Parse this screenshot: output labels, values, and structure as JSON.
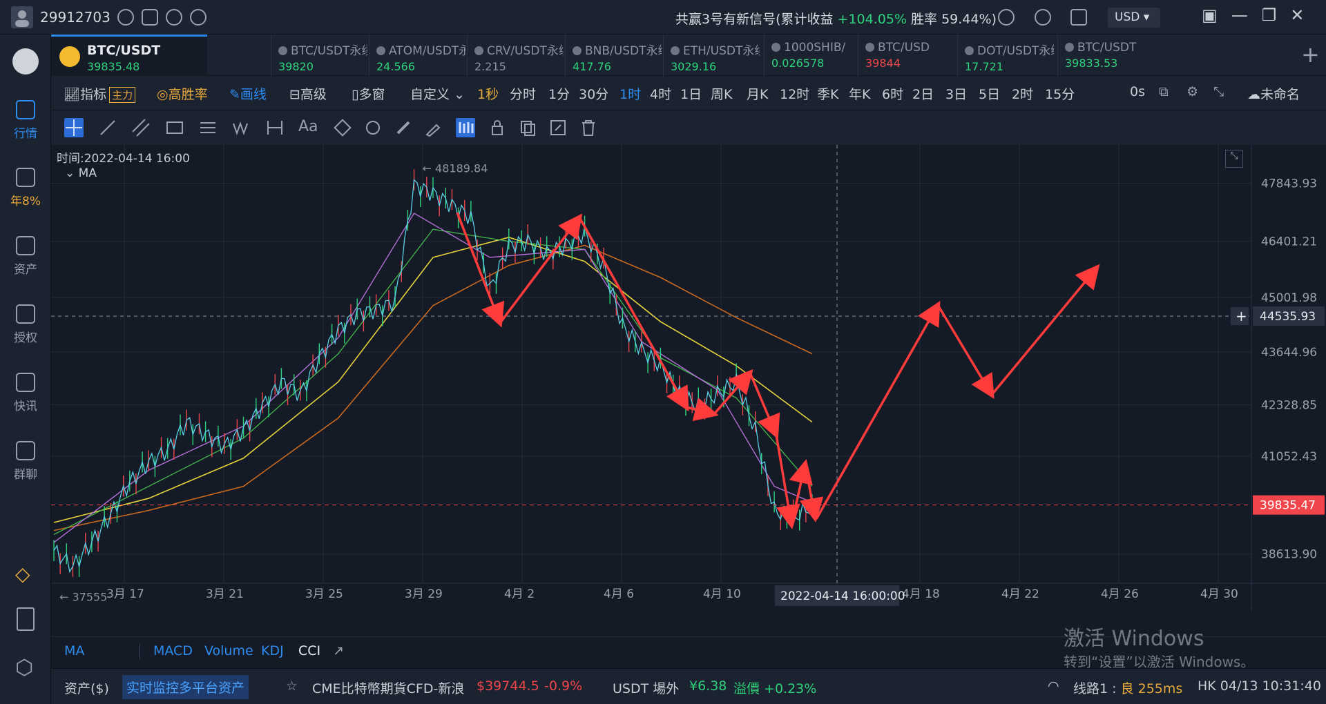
{
  "topbar": {
    "user_id": "29912703",
    "signal_prefix": "共赢3号有新信号(累计收益 ",
    "signal_gain": "+104.05%",
    "signal_winrate": " 胜率 59.44%)",
    "currency": "USD"
  },
  "sidebar": {
    "items": [
      {
        "label": "行情",
        "icon": "market-icon"
      },
      {
        "label": "年8%",
        "icon": "earn-icon"
      },
      {
        "label": "资产",
        "icon": "wallet-icon"
      },
      {
        "label": "授权",
        "icon": "key-icon"
      },
      {
        "label": "快讯",
        "icon": "news-icon"
      },
      {
        "label": "群聊",
        "icon": "chat-icon"
      }
    ]
  },
  "tabs": [
    {
      "name": "BTC/USDT",
      "price": "39835.48",
      "color": "green"
    },
    {
      "name": "BTC/USDT永续",
      "price": "39820",
      "color": "green"
    },
    {
      "name": "ATOM/USDT永续",
      "price": "24.566",
      "color": "green"
    },
    {
      "name": "CRV/USDT永续",
      "price": "2.215",
      "color": "gray"
    },
    {
      "name": "BNB/USDT永续",
      "price": "417.76",
      "color": "green"
    },
    {
      "name": "ETH/USDT永续",
      "price": "3029.16",
      "color": "green"
    },
    {
      "name": "1000SHIB/",
      "price": "0.026578",
      "color": "green"
    },
    {
      "name": "BTC/USD",
      "price": "39844",
      "color": "red"
    },
    {
      "name": "DOT/USDT永续",
      "price": "17.721",
      "color": "green"
    },
    {
      "name": "BTC/USDT",
      "price": "39833.53",
      "color": "green"
    }
  ],
  "interval_bar": {
    "indicator": "指标",
    "main_tag": "主力",
    "high_win": "高胜率",
    "draw": "画线",
    "advanced": "高级",
    "multi": "多窗",
    "custom": "自定义",
    "intervals": [
      "1秒",
      "分时",
      "1分",
      "30分",
      "1时",
      "4时",
      "1日",
      "周K",
      "月K",
      "12时",
      "季K",
      "年K",
      "6时",
      "2日",
      "3日",
      "5日",
      "2时",
      "15分"
    ],
    "active_interval": "1时",
    "countdown": "0s",
    "layout_name": "未命名"
  },
  "chart": {
    "time_label": "时间:2022-04-14 16:00",
    "ma_label": "MA",
    "high_label": "← 48189.84",
    "low_label": "← 37555",
    "crosshair_date": "2022-04-14 16:00:00",
    "crosshair_price": "44535.93",
    "current_price": "39835.47",
    "price_ticks": [
      "47843.93",
      "46401.21",
      "45001.98",
      "43644.96",
      "42328.85",
      "41052.43",
      "38613.90"
    ],
    "date_ticks": [
      "3月 17",
      "3月 21",
      "3月 25",
      "3月 29",
      "4月 2",
      "4月 6",
      "4月 10",
      "4月 18",
      "4月 22",
      "4月 26",
      "4月 30"
    ]
  },
  "chart_data": {
    "type": "line",
    "ylim": [
      37200,
      48800
    ],
    "yticks": [
      47843.93,
      46401.21,
      45001.98,
      43644.96,
      42328.85,
      41052.43,
      38613.9
    ],
    "high": 48189.84,
    "low": 37555,
    "current_price": 39835.47,
    "crosshair_price": 44535.93,
    "price_path": [
      [
        0,
        38700
      ],
      [
        2,
        38300
      ],
      [
        4,
        38900
      ],
      [
        6,
        39600
      ],
      [
        8,
        40400
      ],
      [
        10,
        40900
      ],
      [
        12,
        41200
      ],
      [
        14,
        41900
      ],
      [
        16,
        41600
      ],
      [
        18,
        41300
      ],
      [
        20,
        41700
      ],
      [
        22,
        42300
      ],
      [
        24,
        42900
      ],
      [
        26,
        42600
      ],
      [
        28,
        43500
      ],
      [
        30,
        44200
      ],
      [
        32,
        44600
      ],
      [
        34,
        44700
      ],
      [
        36,
        44900
      ],
      [
        38,
        47800
      ],
      [
        40,
        47600
      ],
      [
        42,
        47300
      ],
      [
        44,
        47000
      ],
      [
        46,
        45200
      ],
      [
        48,
        46300
      ],
      [
        50,
        46400
      ],
      [
        52,
        46100
      ],
      [
        54,
        46300
      ],
      [
        56,
        46600
      ],
      [
        58,
        45800
      ],
      [
        60,
        44300
      ],
      [
        62,
        43700
      ],
      [
        64,
        43300
      ],
      [
        66,
        42600
      ],
      [
        68,
        42300
      ],
      [
        70,
        42600
      ],
      [
        72,
        42900
      ],
      [
        74,
        41700
      ],
      [
        76,
        39700
      ],
      [
        78,
        39500
      ],
      [
        80,
        39835
      ]
    ],
    "ma_fast": [
      [
        0,
        38900
      ],
      [
        10,
        40700
      ],
      [
        20,
        41800
      ],
      [
        30,
        44000
      ],
      [
        38,
        47100
      ],
      [
        46,
        46000
      ],
      [
        56,
        46200
      ],
      [
        62,
        43900
      ],
      [
        70,
        42700
      ],
      [
        76,
        40300
      ],
      [
        80,
        39900
      ]
    ],
    "ma_mid": [
      [
        0,
        39100
      ],
      [
        10,
        40300
      ],
      [
        20,
        41500
      ],
      [
        30,
        43600
      ],
      [
        40,
        46700
      ],
      [
        48,
        46400
      ],
      [
        56,
        46200
      ],
      [
        64,
        43500
      ],
      [
        72,
        42500
      ],
      [
        80,
        40300
      ]
    ],
    "ma_slow": [
      [
        0,
        39400
      ],
      [
        10,
        40000
      ],
      [
        20,
        41000
      ],
      [
        30,
        42900
      ],
      [
        40,
        46000
      ],
      [
        48,
        46500
      ],
      [
        56,
        45900
      ],
      [
        64,
        44400
      ],
      [
        72,
        43300
      ],
      [
        80,
        41900
      ]
    ],
    "ma_long": [
      [
        0,
        39200
      ],
      [
        10,
        39700
      ],
      [
        20,
        40300
      ],
      [
        30,
        42000
      ],
      [
        40,
        44800
      ],
      [
        48,
        45800
      ],
      [
        56,
        46300
      ],
      [
        64,
        45500
      ],
      [
        72,
        44500
      ],
      [
        80,
        43600
      ]
    ],
    "annotation_arrows": "red zigzag arrows drawn on chart"
  },
  "legend": {
    "ma": "MA",
    "macd": "MACD",
    "volume": "Volume",
    "kdj": "KDJ",
    "cci": "CCI"
  },
  "status": {
    "assets": "资产($)",
    "monitor": "实时监控多平台资产",
    "cme_label": "CME比特幣期貨CFD-新浪",
    "cme_price": "$39744.5",
    "cme_change": "-0.9%",
    "usdt_label": "USDT 場外",
    "usdt_price": "¥6.38",
    "premium": "溢價 +0.23%",
    "line_prefix": "线路1 : ",
    "line_quality": "良 255ms",
    "clock": "HK  04/13 10:31:40"
  },
  "watermark": {
    "line1": "激活 Windows",
    "line2": "转到“设置”以激活 Windows。"
  },
  "colors": {
    "accent": "#2d8cf0",
    "up": "#2fd37e",
    "down": "#f0464b",
    "gold": "#e8a93c"
  }
}
